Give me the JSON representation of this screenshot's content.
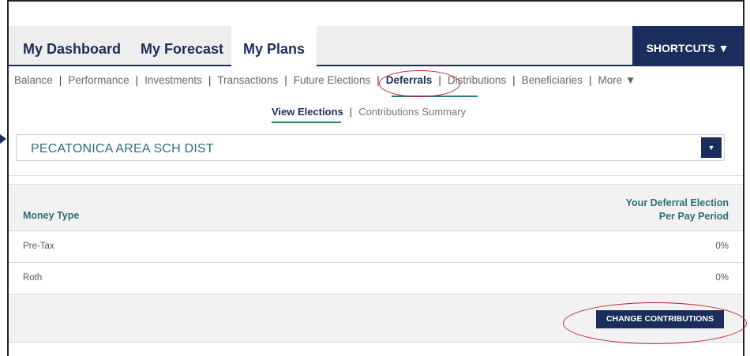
{
  "nav": {
    "tabs": [
      {
        "label": "My Dashboard"
      },
      {
        "label": "My Forecast"
      },
      {
        "label": "My Plans"
      }
    ],
    "shortcuts_label": "SHORTCUTS ▼"
  },
  "subnav": {
    "items": [
      "Balance",
      "Performance",
      "Investments",
      "Transactions",
      "Future Elections",
      "Deferrals",
      "Distributions",
      "Beneficiaries",
      "More ▼"
    ],
    "active": "Deferrals"
  },
  "subsubnav": {
    "items": [
      "View Elections",
      "Contributions Summary"
    ]
  },
  "plan_select": {
    "value": "PECATONICA AREA SCH DIST"
  },
  "table": {
    "headers": {
      "money_type": "Money Type",
      "election_line1": "Your Deferral Election",
      "election_line2": "Per Pay Period"
    },
    "rows": [
      {
        "money_type": "Pre-Tax",
        "election": "0%"
      },
      {
        "money_type": "Roth",
        "election": "0%"
      }
    ]
  },
  "actions": {
    "change_contributions": "CHANGE CONTRIBUTIONS"
  },
  "colors": {
    "navy": "#1b2d5c",
    "teal": "#2a6f74",
    "annotation_red": "#c02030"
  }
}
